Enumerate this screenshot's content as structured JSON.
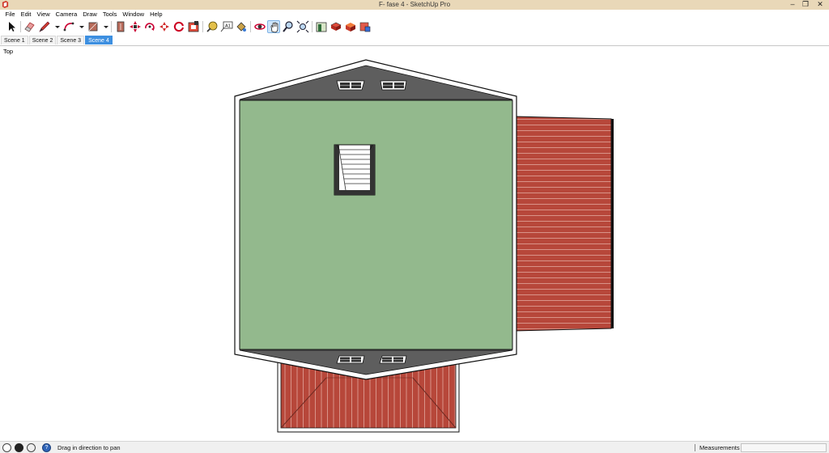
{
  "window": {
    "title": "F- fase 4 - SketchUp Pro",
    "controls": [
      "minimize-icon",
      "restore-icon",
      "close-icon"
    ]
  },
  "menu": {
    "items": [
      {
        "label": "File"
      },
      {
        "label": "Edit"
      },
      {
        "label": "View"
      },
      {
        "label": "Camera"
      },
      {
        "label": "Draw"
      },
      {
        "label": "Tools"
      },
      {
        "label": "Window"
      },
      {
        "label": "Help"
      }
    ]
  },
  "toolbar": {
    "tools": [
      "select-icon",
      "eraser-icon",
      "pencil-icon",
      "dropdown-arrow-icon",
      "arc-icon",
      "dropdown-arrow-icon",
      "rectangle-icon",
      "dropdown-arrow-icon",
      "push-pull-icon",
      "move-icon",
      "rotate-icon",
      "scale-icon",
      "offset-icon",
      "follow-me-icon",
      "tape-measure-icon",
      "text-icon",
      "paint-bucket-icon",
      "orbit-icon",
      "pan-icon",
      "zoom-icon",
      "zoom-extents-icon",
      "warehouse-icon",
      "extension-warehouse-icon",
      "layout-icon",
      "style-builder-icon"
    ],
    "active_tool": "pan-icon"
  },
  "scenes": {
    "tabs": [
      {
        "label": "Scene 1",
        "active": false
      },
      {
        "label": "Scene 2",
        "active": false
      },
      {
        "label": "Scene 3",
        "active": false
      },
      {
        "label": "Scene 4",
        "active": true
      }
    ]
  },
  "viewport": {
    "view_label": "Top",
    "colors": {
      "floor": "#93b98d",
      "roof_gray": "#5f5f5f",
      "roof_red": "#b7473a",
      "plank_line": "#e7b3aa",
      "outline": "#000000"
    }
  },
  "status": {
    "message": "Drag in direction to pan",
    "measurements_label": "Measurements",
    "measurements_value": "",
    "icons": [
      "info-icon",
      "user-icon",
      "user-outline-icon",
      "help-icon"
    ]
  }
}
